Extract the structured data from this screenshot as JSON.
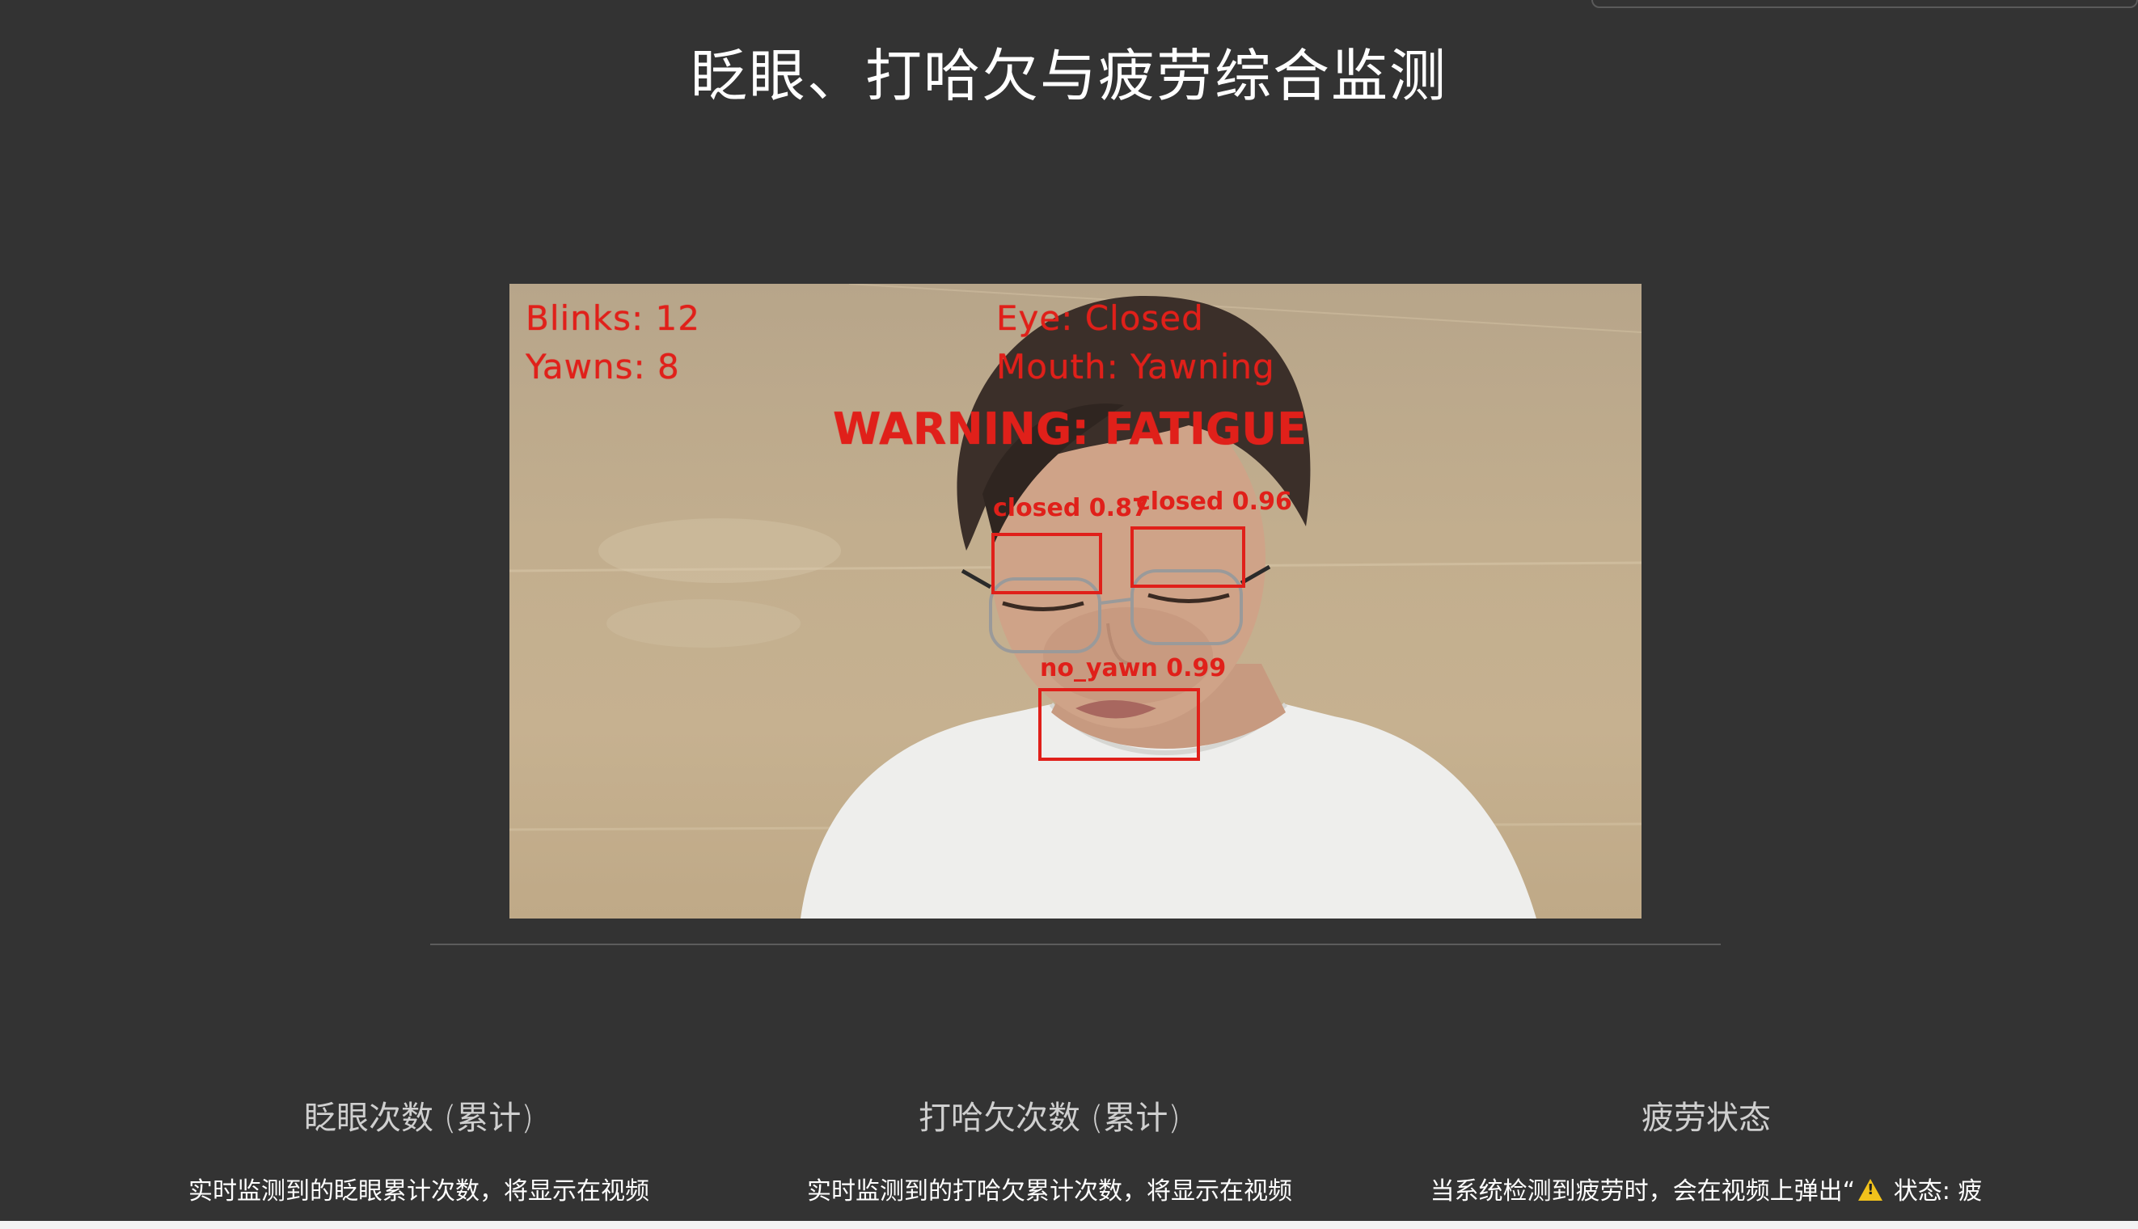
{
  "page": {
    "title": "眨眼、打哈欠与疲劳综合监测"
  },
  "video": {
    "overlay": {
      "blinks": "Blinks: 12",
      "yawns": "Yawns: 8",
      "eye_state": "Eye: Closed",
      "mouth_state": "Mouth: Yawning",
      "warning": "WARNING: FATIGUE"
    },
    "detections": [
      {
        "label": "closed 0.87",
        "class": "closed",
        "confidence": 0.87
      },
      {
        "label": "closed 0.96",
        "class": "closed",
        "confidence": 0.96
      },
      {
        "label": "no_yawn 0.99",
        "class": "no_yawn",
        "confidence": 0.99
      }
    ],
    "overlay_color": "#e0201a"
  },
  "cards": [
    {
      "title": "眨眼次数 (累计)",
      "description": "实时监测到的眨眼累计次数，将显示在视频"
    },
    {
      "title": "打哈欠次数 (累计)",
      "description": "实时监测到的打哈欠累计次数，将显示在视频"
    },
    {
      "title": "疲劳状态",
      "description_before_icon": "当系统检测到疲劳时，会在视频上弹出“",
      "icon": "warning-icon",
      "description_after_icon": " 状态: 疲"
    }
  ],
  "colors": {
    "background": "#333333",
    "title": "#ffffff",
    "warning_icon": "#f2c21b"
  }
}
